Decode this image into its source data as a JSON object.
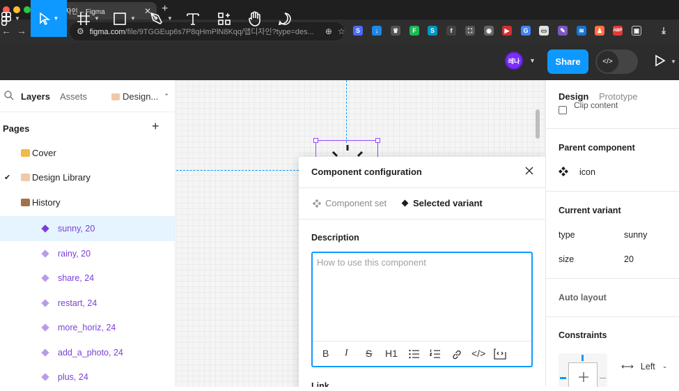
{
  "browser": {
    "tab_title": "앱디자인 – Figma",
    "tab_close": "✕",
    "new_tab": "+",
    "url_host": "figma.com",
    "url_path": "/file/9TGGEup6s7P8qHmPlN8Kqq/앱디자인?type=des..."
  },
  "toolbar": {
    "share_label": "Share",
    "avatar_initials": "레나",
    "dev_mode_label": "</>"
  },
  "left_panel": {
    "tabs": [
      "Layers",
      "Assets"
    ],
    "page_switcher": "Design...",
    "pages_header": "Pages",
    "pages": [
      {
        "label": "Cover",
        "selected": false
      },
      {
        "label": "Design Library",
        "selected": true
      },
      {
        "label": "History",
        "selected": false
      }
    ],
    "layers": [
      {
        "label": "sunny, 20",
        "selected": true
      },
      {
        "label": "rainy, 20",
        "selected": false
      },
      {
        "label": "share, 24",
        "selected": false
      },
      {
        "label": "restart, 24",
        "selected": false
      },
      {
        "label": "more_horiz, 24",
        "selected": false
      },
      {
        "label": "add_a_photo, 24",
        "selected": false
      },
      {
        "label": "plus, 24",
        "selected": false
      }
    ]
  },
  "modal": {
    "title": "Component configuration",
    "tab_component_set": "Component set",
    "tab_selected_variant": "Selected variant",
    "description_label": "Description",
    "description_placeholder": "How to use this component",
    "description_value": "",
    "format_buttons": [
      "B",
      "I",
      "S",
      "H1",
      "bulleted-list",
      "numbered-list",
      "link",
      "code",
      "code-block"
    ],
    "link_label": "Link"
  },
  "right_panel": {
    "tabs": [
      "Design",
      "Prototype"
    ],
    "clip_content_label": "Clip content",
    "parent_component_header": "Parent component",
    "parent_component_name": "icon",
    "current_variant_header": "Current variant",
    "variant_props": [
      {
        "key": "type",
        "value": "sunny"
      },
      {
        "key": "size",
        "value": "20"
      }
    ],
    "auto_layout_header": "Auto layout",
    "constraints_header": "Constraints",
    "constraint_horizontal": "Left"
  },
  "colors": {
    "accent": "#0d99ff",
    "component_purple": "#7b3fd6",
    "toolbar_bg": "#2c2c2c",
    "selection_bg": "#e5f4ff"
  }
}
